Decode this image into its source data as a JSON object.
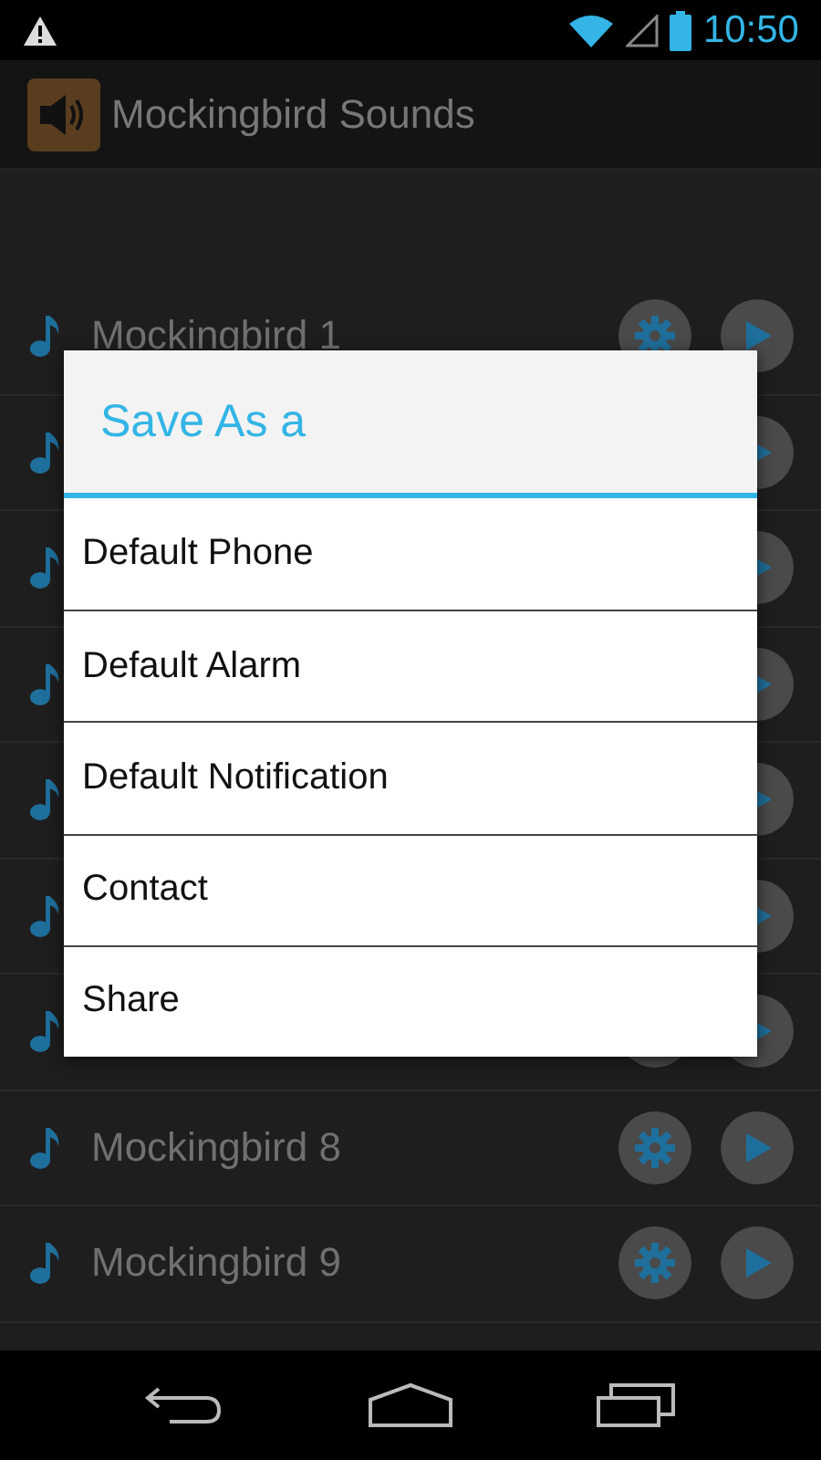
{
  "status_bar": {
    "time": "10:50"
  },
  "app_bar": {
    "title": "Mockingbird Sounds"
  },
  "sounds": [
    {
      "kind": "titled",
      "name": "Mockingbird 1"
    },
    {
      "kind": "covered"
    },
    {
      "kind": "covered"
    },
    {
      "kind": "covered"
    },
    {
      "kind": "covered"
    },
    {
      "kind": "partly_covered"
    },
    {
      "kind": "partly_covered"
    },
    {
      "kind": "titled",
      "name": "Mockingbird 8"
    },
    {
      "kind": "titled",
      "name": "Mockingbird 9"
    }
  ],
  "dialog": {
    "title": "Save As a",
    "options": [
      "Default Phone",
      "Default Alarm",
      "Default Notification",
      "Contact",
      "Share"
    ]
  }
}
